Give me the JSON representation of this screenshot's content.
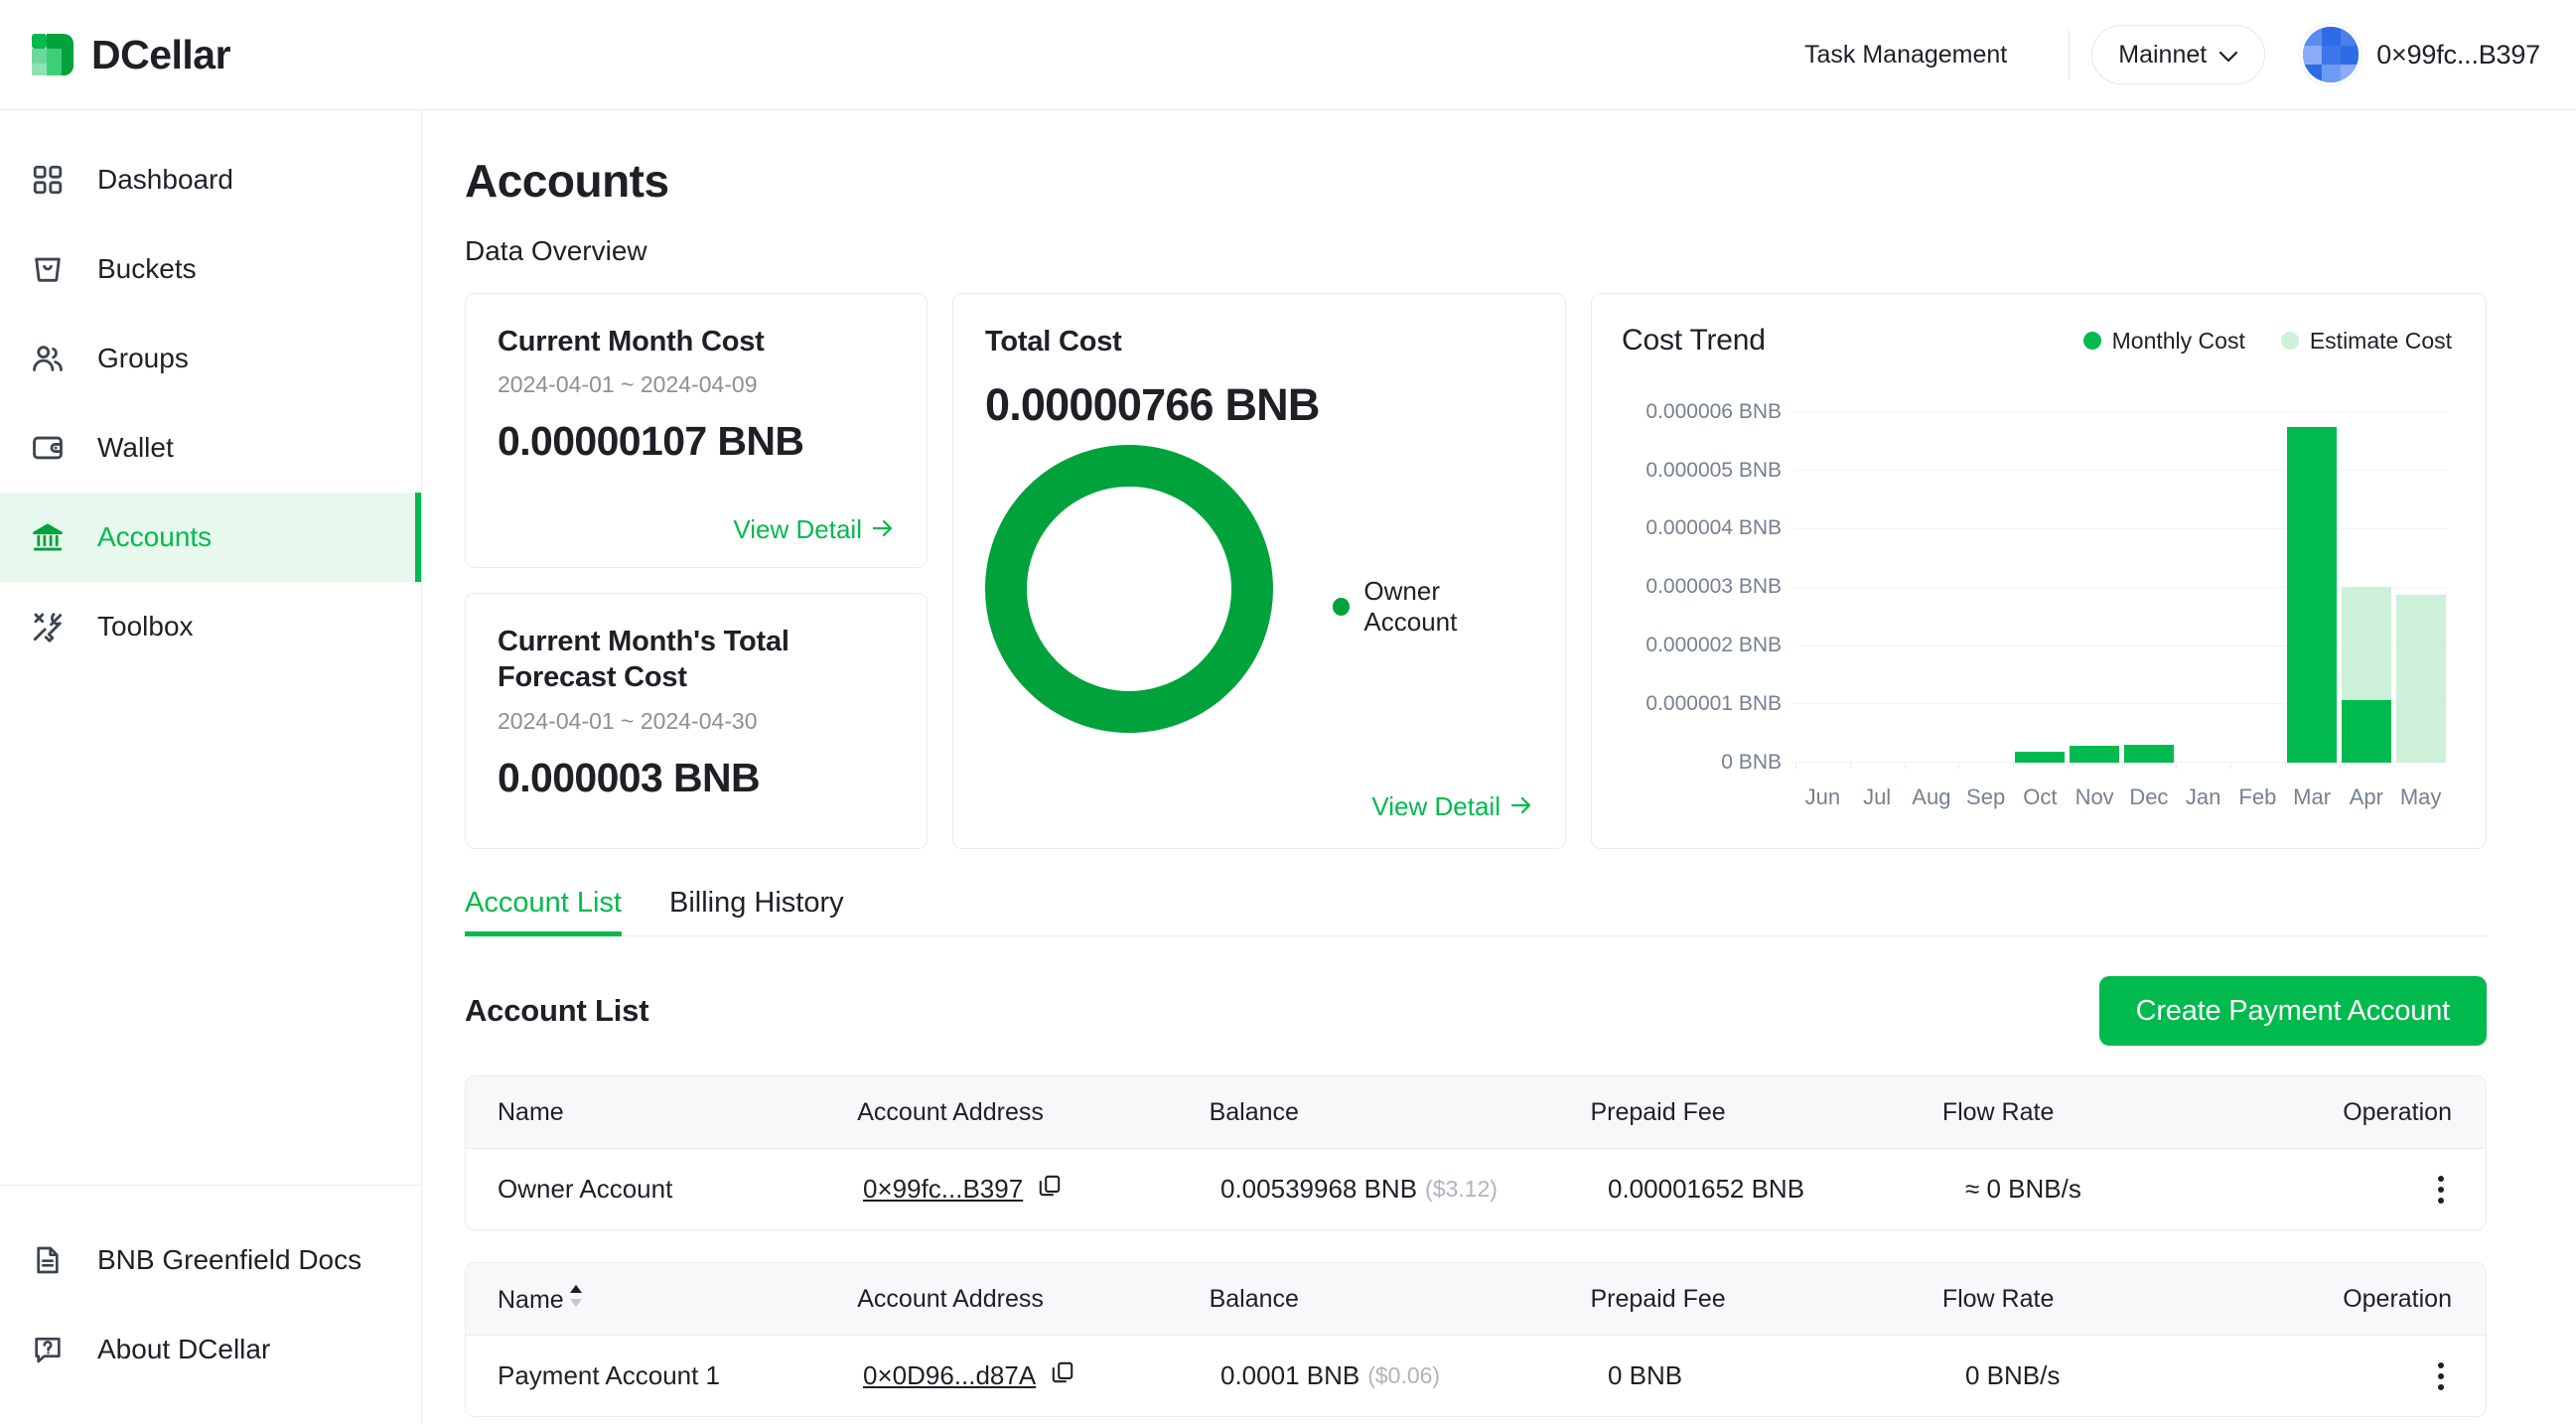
{
  "header": {
    "logo_text": "DCellar",
    "task_management": "Task Management",
    "network": "Mainnet",
    "account_address": "0×99fc...B397"
  },
  "sidebar": {
    "top_items": [
      {
        "label": "Dashboard",
        "icon": "dashboard-grid-icon"
      },
      {
        "label": "Buckets",
        "icon": "bucket-icon"
      },
      {
        "label": "Groups",
        "icon": "groups-people-icon"
      },
      {
        "label": "Wallet",
        "icon": "wallet-icon"
      },
      {
        "label": "Accounts",
        "icon": "bank-icon"
      },
      {
        "label": "Toolbox",
        "icon": "tools-icon"
      }
    ],
    "bottom_items": [
      {
        "label": "BNB Greenfield Docs",
        "icon": "document-icon"
      },
      {
        "label": "About DCellar",
        "icon": "question-bubble-icon"
      }
    ],
    "active_label": "Accounts"
  },
  "main": {
    "page_title": "Accounts",
    "data_overview_label": "Data Overview",
    "cards": {
      "current_month": {
        "title": "Current Month Cost",
        "range": "2024-04-01 ~ 2024-04-09",
        "amount": "0.00000107 BNB",
        "view_detail": "View Detail"
      },
      "forecast": {
        "title": "Current Month's Total Forecast Cost",
        "range": "2024-04-01 ~ 2024-04-30",
        "amount": "0.000003 BNB"
      },
      "total_cost": {
        "title": "Total Cost",
        "amount": "0.00000766 BNB",
        "legend_label": "Owner Account",
        "legend_color": "#00A23B",
        "view_detail": "View Detail"
      }
    },
    "tabs": [
      {
        "label": "Account List",
        "active": true
      },
      {
        "label": "Billing History",
        "active": false
      }
    ],
    "list_title": "Account List",
    "create_button": "Create Payment Account",
    "tables": [
      {
        "columns": [
          "Name",
          "Account Address",
          "Balance",
          "Prepaid Fee",
          "Flow Rate",
          "Operation"
        ],
        "sortable_first_column": false,
        "rows": [
          {
            "name": "Owner Account",
            "address": "0×99fc...B397",
            "balance": "0.00539968 BNB",
            "balance_usd": "($3.12)",
            "prepaid_fee": "0.00001652 BNB",
            "flow_rate": "≈ 0 BNB/s"
          }
        ]
      },
      {
        "columns": [
          "Name",
          "Account Address",
          "Balance",
          "Prepaid Fee",
          "Flow Rate",
          "Operation"
        ],
        "sortable_first_column": true,
        "rows": [
          {
            "name": "Payment Account 1",
            "address": "0×0D96...d87A",
            "balance": "0.0001 BNB",
            "balance_usd": "($0.06)",
            "prepaid_fee": "0 BNB",
            "flow_rate": "0 BNB/s"
          }
        ]
      }
    ]
  },
  "chart_data": {
    "type": "bar",
    "title": "Cost Trend",
    "xlabel": "",
    "ylabel": "",
    "grid": true,
    "legend_position": "top-right",
    "categories": [
      "Jun",
      "Jul",
      "Aug",
      "Sep",
      "Oct",
      "Nov",
      "Dec",
      "Jan",
      "Feb",
      "Mar",
      "Apr",
      "May"
    ],
    "ytick_labels": [
      "0 BNB",
      "0.000001 BNB",
      "0.000002 BNB",
      "0.000003 BNB",
      "0.000004 BNB",
      "0.000005 BNB",
      "0.000006 BNB"
    ],
    "ytick_values": [
      0,
      1e-06,
      2e-06,
      3e-06,
      4e-06,
      5e-06,
      6e-06
    ],
    "ylim": [
      0,
      6.3e-06
    ],
    "series": [
      {
        "name": "Monthly Cost",
        "color": "#00BA4D",
        "values": [
          0,
          0,
          0,
          0,
          1.9e-07,
          2.9e-07,
          3.1e-07,
          0,
          0,
          5.75e-06,
          1.07e-06,
          0
        ]
      },
      {
        "name": "Estimate Cost",
        "color": "#CDF0D9",
        "values": [
          0,
          0,
          0,
          0,
          0,
          0,
          0,
          0,
          0,
          0,
          3.02e-06,
          2.88e-06
        ]
      }
    ]
  }
}
